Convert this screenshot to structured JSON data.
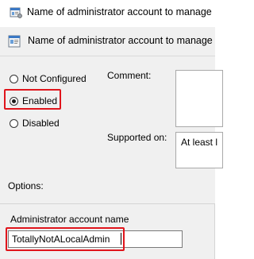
{
  "window": {
    "title": "Name of administrator account to manage",
    "title_icon": "group-policy-settings-icon"
  },
  "setting": {
    "header": "Name of administrator account to manage",
    "header_icon": "group-policy-settings-icon"
  },
  "state": {
    "options": [
      {
        "label": "Not Configured",
        "selected": false
      },
      {
        "label": "Enabled",
        "selected": true
      },
      {
        "label": "Disabled",
        "selected": false
      }
    ]
  },
  "comment": {
    "label": "Comment:",
    "value": ""
  },
  "supported": {
    "label": "Supported on:",
    "value": "At least l"
  },
  "options_section": {
    "label": "Options:",
    "field_label": "Administrator account name",
    "field_value": "TotallyNotALocalAdmin"
  },
  "colors": {
    "highlight": "#e0151c",
    "panel": "#f0f0f0",
    "field_border": "#7a7a7a"
  }
}
